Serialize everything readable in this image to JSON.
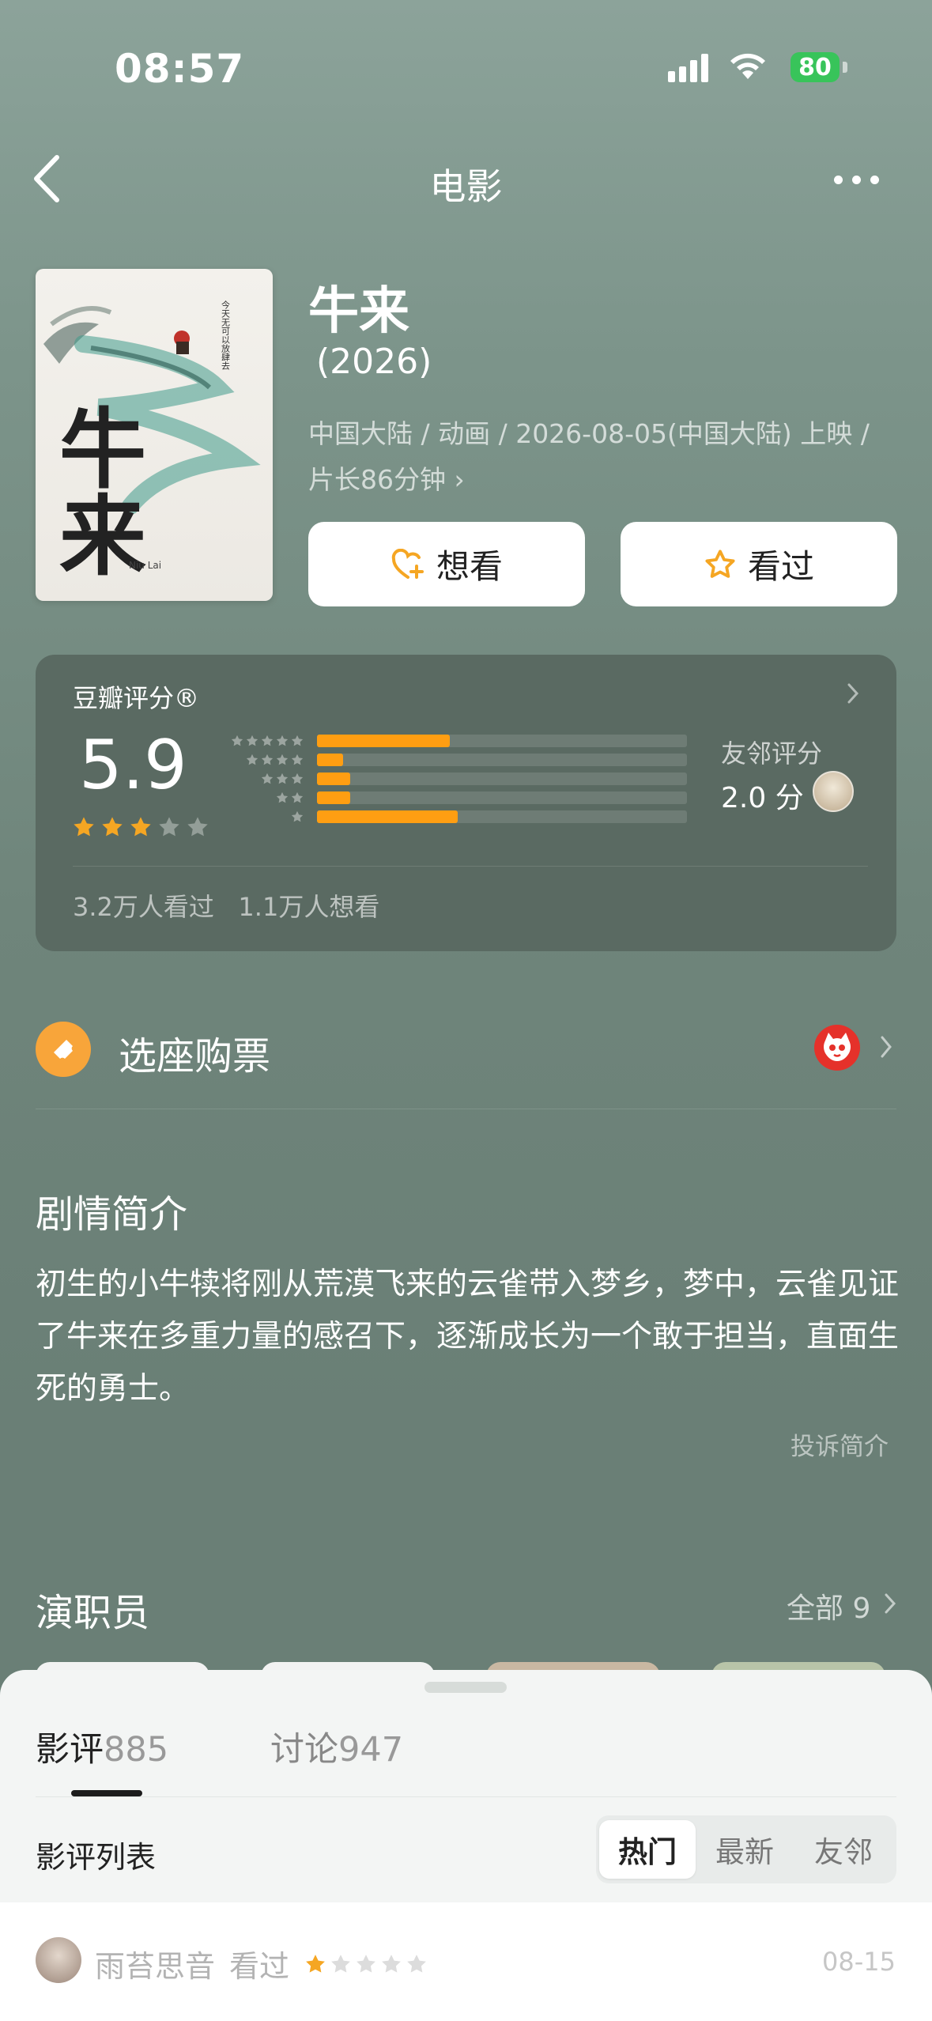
{
  "status_bar": {
    "time": "08:57",
    "battery": "80"
  },
  "nav": {
    "title": "电影"
  },
  "movie": {
    "title": "牛来",
    "year": "(2026)",
    "meta": "中国大陆 / 动画 / 2026-08-05(中国大陆) 上映 / 片长86分钟",
    "meta_chevron": "›",
    "poster_title": "牛来",
    "poster_sub": "Niu Lai"
  },
  "actions": {
    "want_label": "想看",
    "seen_label": "看过"
  },
  "rating": {
    "brand": "豆瓣评分®",
    "score": "5.9",
    "stars": 3,
    "distribution_percent": [
      36,
      7,
      9,
      9,
      38
    ],
    "friend_label": "友邻评分",
    "friend_score": "2.0 分",
    "watched": "3.2万人看过",
    "wanted": "1.1万人想看"
  },
  "tickets": {
    "label": "选座购票"
  },
  "synopsis": {
    "title": "剧情简介",
    "text": "初生的小牛犊将刚从荒漠飞来的云雀带入梦乡，梦中，云雀见证了牛来在多重力量的感召下，逐渐成长为一个敢于担当，直面生死的勇士。",
    "report": "投诉简介"
  },
  "cast": {
    "title": "演职员",
    "all_label": "全部 9"
  },
  "sheet": {
    "tab_review_label": "影评",
    "tab_review_count": "885",
    "tab_discussion_label": "讨论",
    "tab_discussion_count": "947",
    "list_label": "影评列表",
    "sort_options": [
      "热门",
      "最新",
      "友邻"
    ],
    "active_sort": "热门"
  },
  "review": {
    "user": "雨苔思音",
    "action": "看过",
    "stars": 1,
    "date": "08-15"
  },
  "colors": {
    "accent": "#ff9e12",
    "star": "#f5a623",
    "maoyan": "#e5312a"
  }
}
